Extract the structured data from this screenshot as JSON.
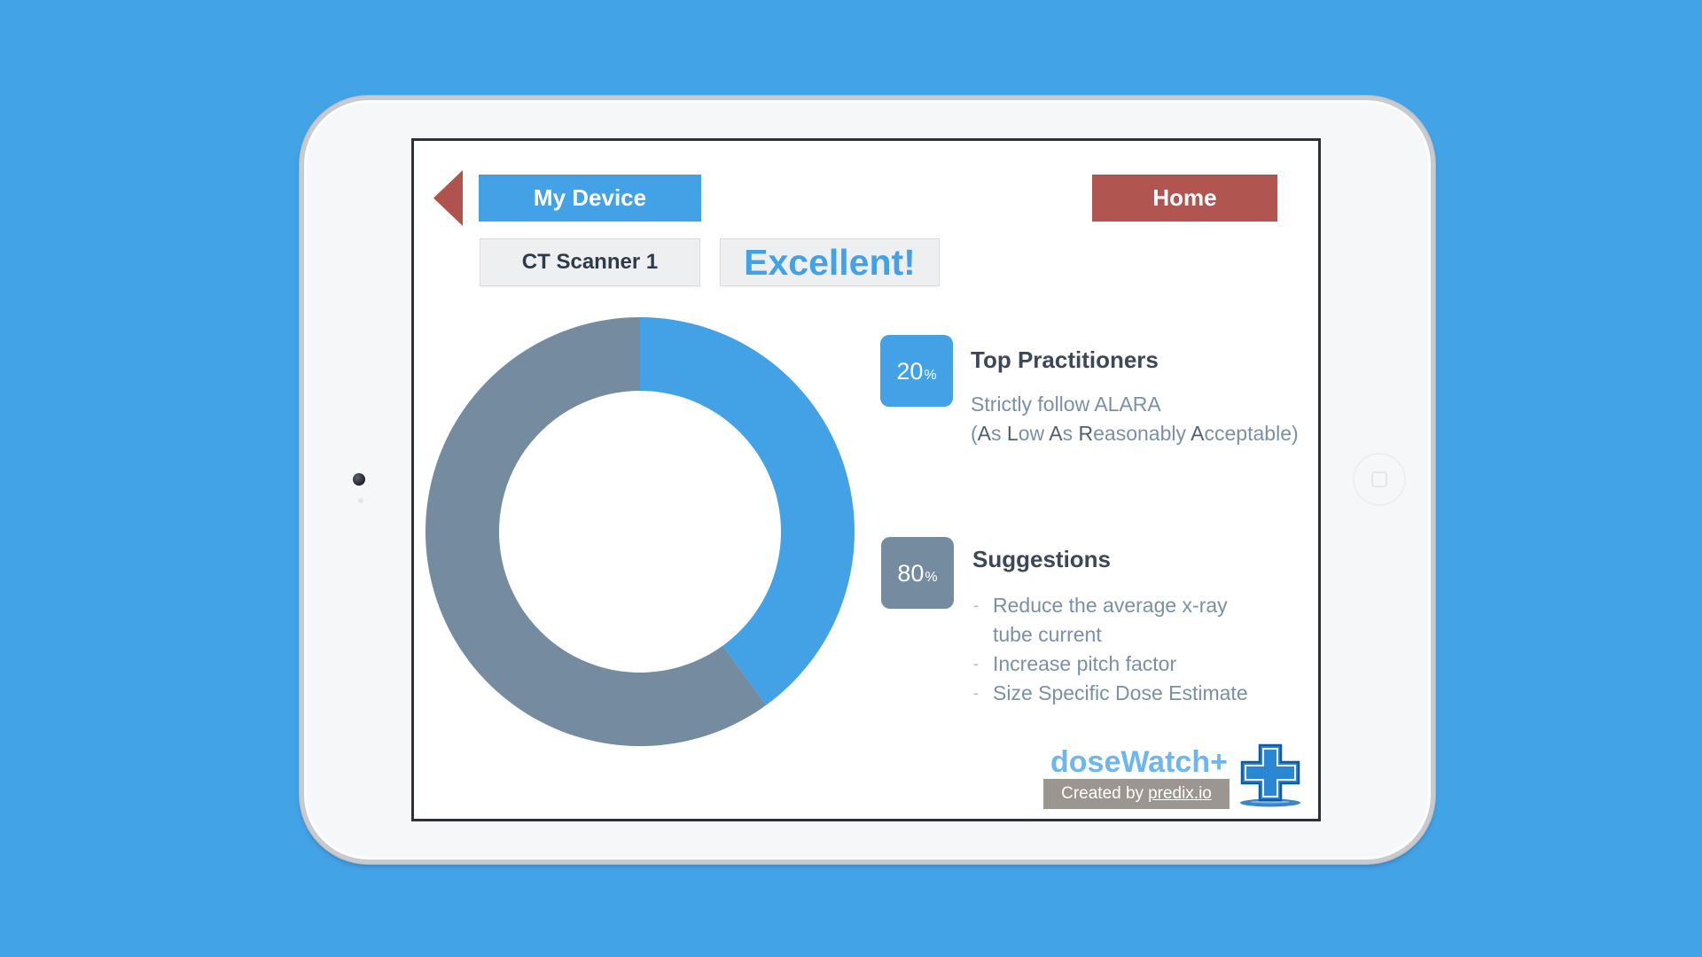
{
  "colors": {
    "background": "#43A3E7",
    "accent": "#43A2E6",
    "home_button": "#B0554F",
    "back_arrow": "#B0534E",
    "muted": "#758BA0",
    "body_text": "#7B8FA7",
    "brand_text": "#6DB6F0",
    "credit_bar": "#9B9690"
  },
  "icons": {
    "back": "back-arrow-icon",
    "logo": "medical-cross-icon",
    "device_home": "home-button-icon",
    "camera": "camera-icon"
  },
  "nav": {
    "my_device_label": "My Device",
    "home_label": "Home"
  },
  "status": {
    "device_name": "CT Scanner 1",
    "rating": "Excellent!"
  },
  "chart_data": {
    "type": "pie",
    "donut": true,
    "values": [
      40,
      60
    ],
    "colors": [
      "#43A2E6",
      "#758BA0"
    ]
  },
  "summary": {
    "top": {
      "percent": "20",
      "percent_unit": "%",
      "title": "Top Practitioners",
      "line1": "Strictly follow ALARA",
      "line2": "(As Low As Reasonably Acceptable)"
    },
    "suggestions": {
      "percent": "80",
      "percent_unit": "%",
      "title": "Suggestions",
      "bullet": "-",
      "items": [
        "Reduce the average x-ray\ntube current",
        "Increase pitch factor",
        "Size Specific Dose Estimate"
      ]
    }
  },
  "branding": {
    "product_name": "doseWatch+",
    "credit_prefix": "Created by",
    "credit_link": "predix.io"
  }
}
